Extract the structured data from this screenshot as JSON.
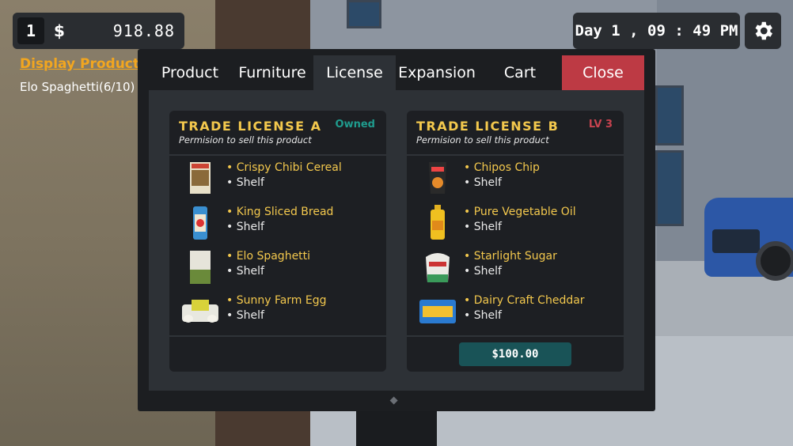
{
  "hud": {
    "level": "1",
    "currency": "$",
    "money": "918.88",
    "time": "Day 1 , 09 : 49 PM",
    "settings_icon": "gear-icon"
  },
  "task": {
    "title": "Display Product",
    "item": "Elo Spaghetti(6/10)"
  },
  "tabs": [
    {
      "label": "Product"
    },
    {
      "label": "Furniture"
    },
    {
      "label": "License"
    },
    {
      "label": "Expansion"
    },
    {
      "label": "Cart"
    },
    {
      "label": "Close"
    }
  ],
  "active_tab": "License",
  "colors": {
    "accent_yellow": "#f3c84d",
    "owned_teal": "#1f9c8e",
    "level_red": "#c8434f",
    "close_red": "#bd3a44",
    "buy_teal": "#195357"
  },
  "licenses": [
    {
      "title": "TRADE LICENSE A",
      "subtitle": "Permision to sell this product",
      "status": "Owned",
      "items": [
        {
          "name": "• Crispy Chibi Cereal",
          "type": "• Shelf"
        },
        {
          "name": "• King Sliced Bread",
          "type": "• Shelf"
        },
        {
          "name": "• Elo Spaghetti",
          "type": "• Shelf"
        },
        {
          "name": "• Sunny Farm Egg",
          "type": "• Shelf"
        }
      ]
    },
    {
      "title": "TRADE LICENSE B",
      "subtitle": "Permision to sell this product",
      "status": "LV 3",
      "price": "$100.00",
      "items": [
        {
          "name": "• Chipos Chip",
          "type": "• Shelf"
        },
        {
          "name": "• Pure Vegetable Oil",
          "type": "• Shelf"
        },
        {
          "name": "• Starlight Sugar",
          "type": "• Shelf"
        },
        {
          "name": "• Dairy Craft Cheddar",
          "type": "• Shelf"
        }
      ]
    }
  ]
}
